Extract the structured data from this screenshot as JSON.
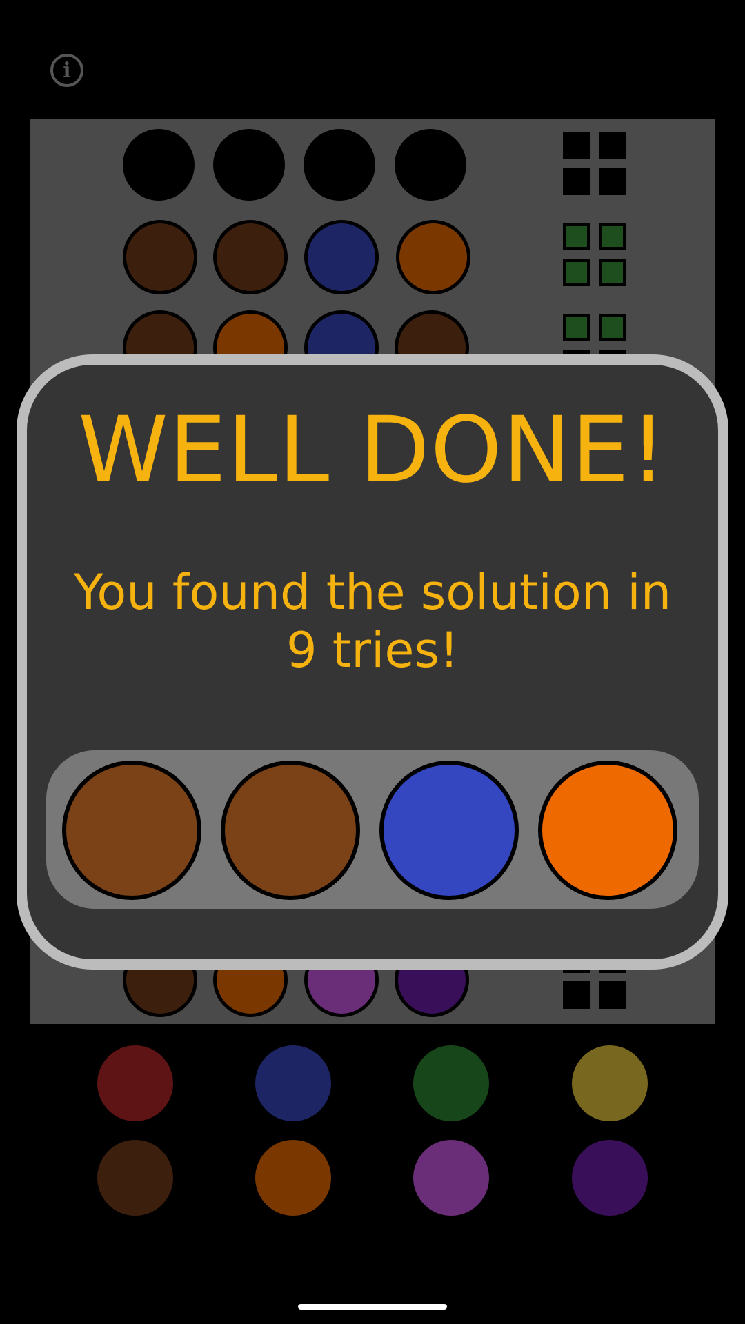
{
  "info_label": "i",
  "board": {
    "row_1": {
      "pegs": [
        "empty-black",
        "empty-black",
        "empty-black",
        "empty-black"
      ],
      "feedback": [
        "black",
        "black",
        "black",
        "black"
      ]
    },
    "row_2": {
      "pegs": [
        "#3d1f0e",
        "#3d1f0e",
        "#1e2565",
        "#7a3800"
      ],
      "feedback": [
        "green",
        "green",
        "green",
        "green"
      ]
    },
    "row_3": {
      "pegs": [
        "#3d1f0e",
        "#7a3800",
        "#1e2565",
        "#3d1f0e"
      ],
      "feedback": [
        "green",
        "green"
      ]
    },
    "row_last": {
      "pegs": [
        "#3d1f0e",
        "#7a3800",
        "#6a2d78",
        "#3a0f5a"
      ],
      "feedback": [
        "black",
        "black"
      ]
    }
  },
  "palette": {
    "colors": [
      "#5e1414",
      "#1e2565",
      "#17461a",
      "#78671e",
      "#3d1f0e",
      "#7a3800",
      "#6a2d78",
      "#3a0f5a"
    ]
  },
  "modal": {
    "title": "WELL DONE!",
    "message_line1": "You found the solution in",
    "message_line2": "9 tries!",
    "solution_colors": [
      "#7c4217",
      "#7c4217",
      "#3446c0",
      "#ee6a00"
    ]
  },
  "colors": {
    "accent": "#f6b30f",
    "board_bg": "#4a4a4a",
    "modal_bg": "#353535",
    "modal_border": "#bcbcbc"
  }
}
